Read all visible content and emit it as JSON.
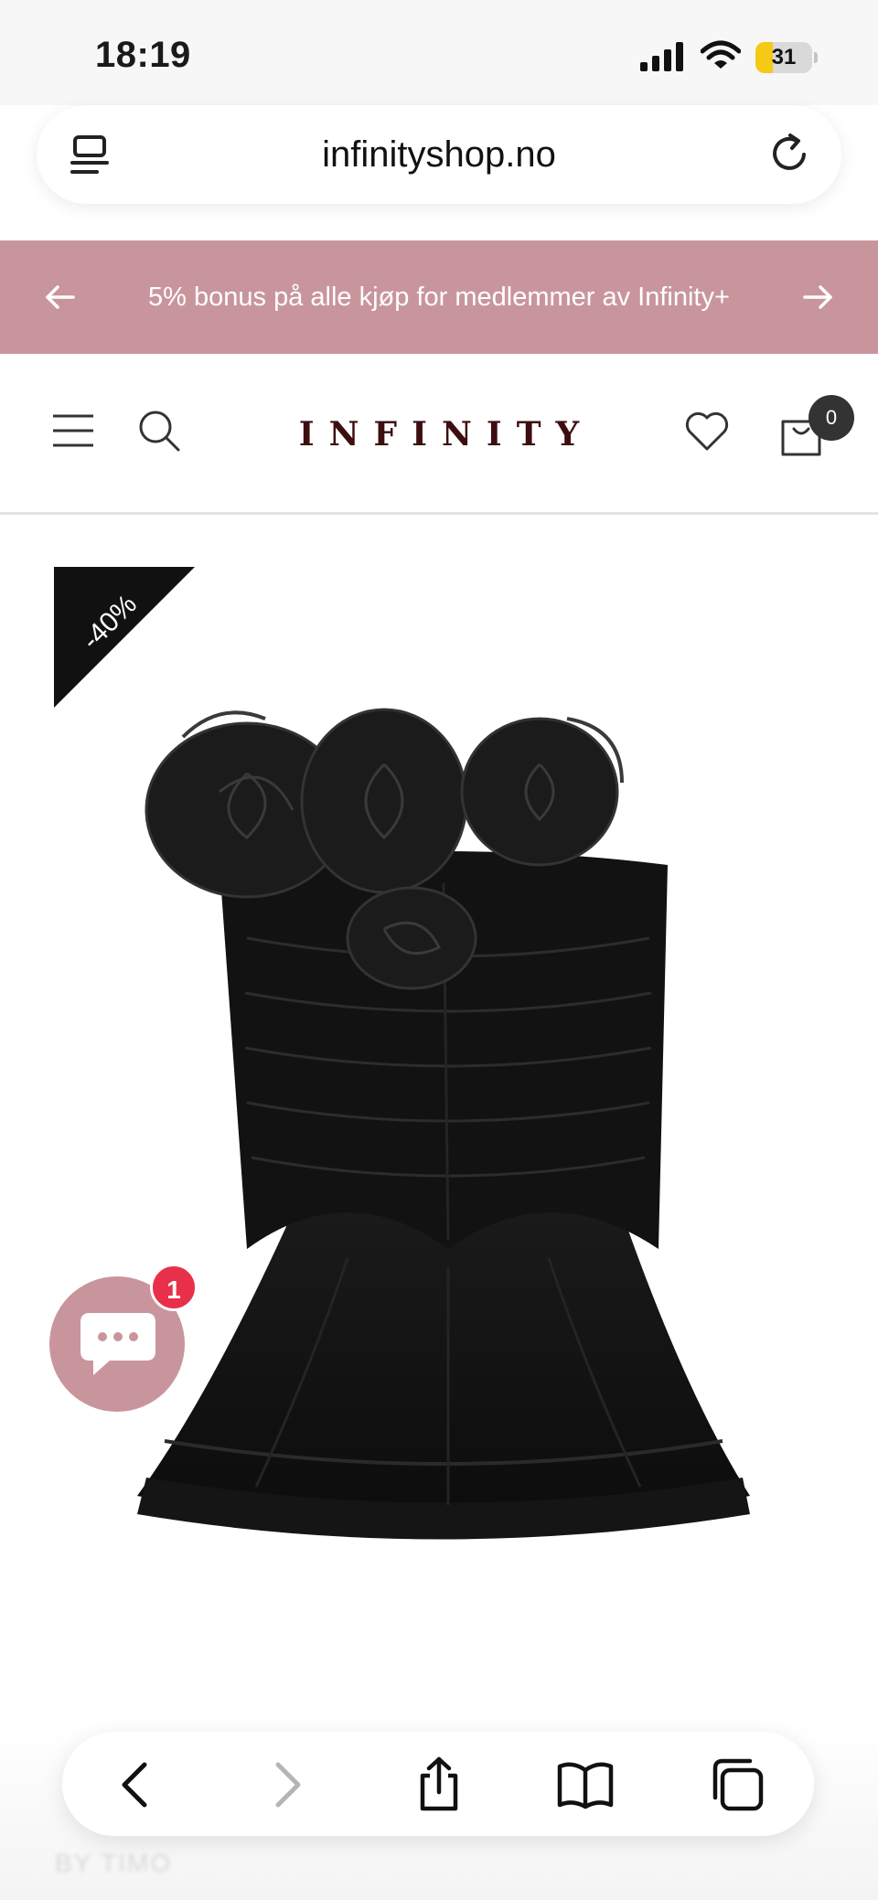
{
  "status_bar": {
    "time": "18:19",
    "battery_level": "31",
    "icons": [
      "signal-icon",
      "wifi-icon",
      "battery-icon"
    ]
  },
  "browser": {
    "url": "infinityshop.no",
    "icons": [
      "page-menu-icon",
      "reload-icon"
    ]
  },
  "announcement": {
    "text": "5% bonus på alle kjøp for medlemmer av Infinity+",
    "background": "#c9959d",
    "icons": [
      "arrow-left-icon",
      "arrow-right-icon"
    ]
  },
  "header": {
    "logo": "INFINITY",
    "cart_count": "0",
    "icons": [
      "menu-icon",
      "search-icon",
      "heart-icon",
      "cart-icon"
    ]
  },
  "product": {
    "discount_badge": "-40%",
    "image_alt": "black strapless mini dress with rosettes"
  },
  "chat": {
    "unread_count": "1",
    "icon": "chat-bubble-icon",
    "accent": "#c9959d"
  },
  "below_fold_text": "BY TIMO",
  "toolbar": {
    "icons": [
      "back-icon",
      "forward-icon",
      "share-icon",
      "bookmarks-icon",
      "tabs-icon"
    ]
  }
}
